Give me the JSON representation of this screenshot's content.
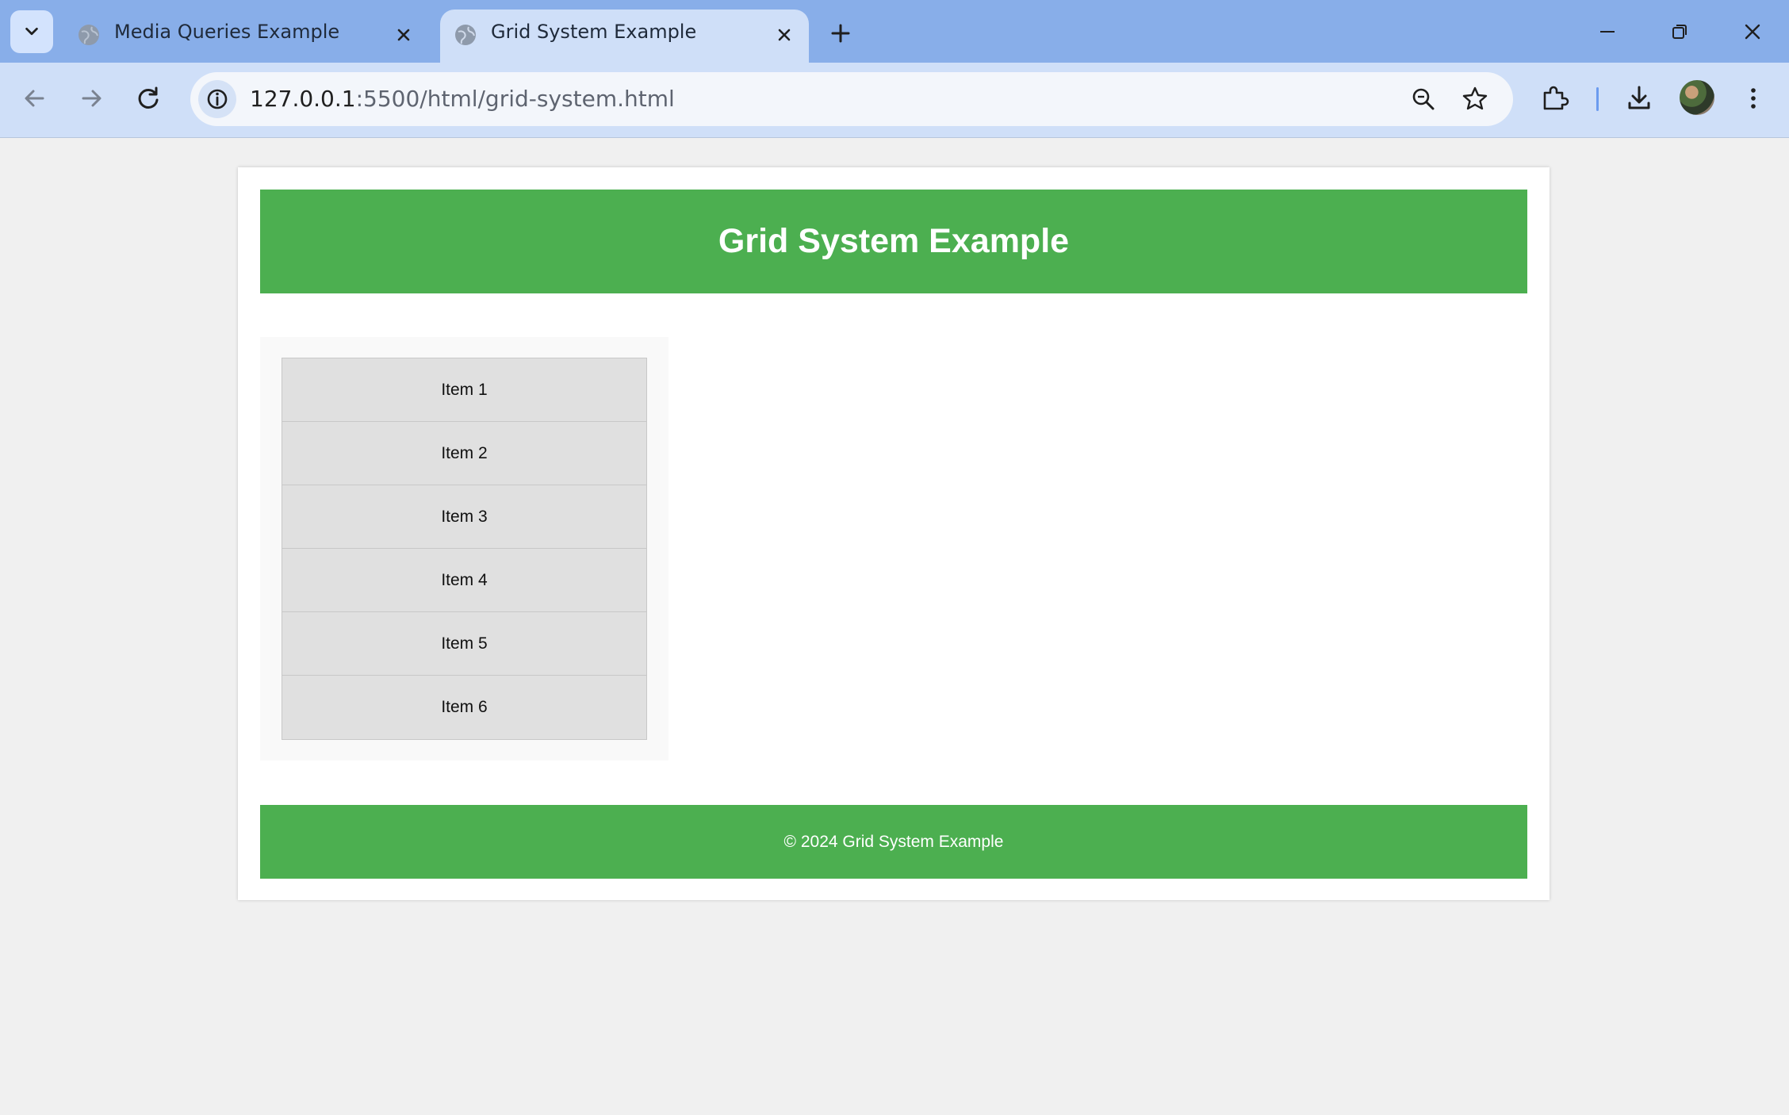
{
  "browser": {
    "tabs": [
      {
        "title": "Media Queries Example",
        "active": false
      },
      {
        "title": "Grid System Example",
        "active": true
      }
    ],
    "address": {
      "host": "127.0.0.1",
      "path": ":5500/html/grid-system.html"
    },
    "accent_color": "#88aee9"
  },
  "page": {
    "header_title": "Grid System Example",
    "items": [
      "Item 1",
      "Item 2",
      "Item 3",
      "Item 4",
      "Item 5",
      "Item 6"
    ],
    "footer_text": "© 2024 Grid System Example",
    "brand_color": "#4caf50"
  }
}
